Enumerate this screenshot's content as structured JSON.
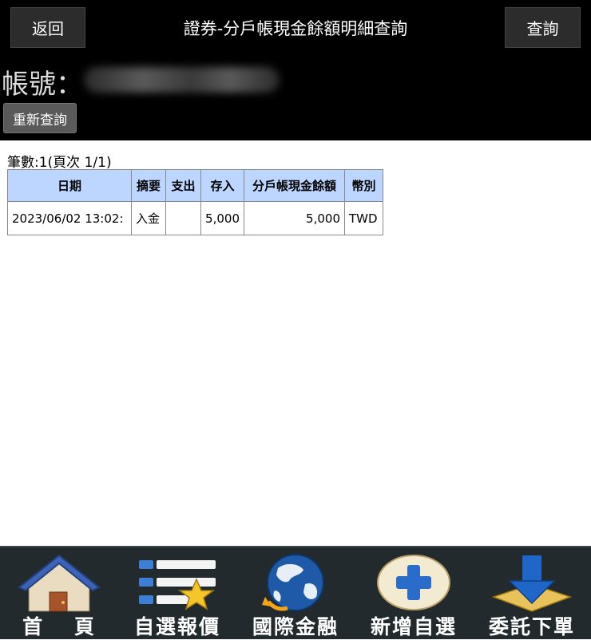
{
  "header": {
    "back_label": "返回",
    "title": "證券-分戶帳現金餘額明細查詢",
    "query_label": "查詢",
    "account_label": "帳號：",
    "requery_label": "重新查詢"
  },
  "result": {
    "count_text": "筆數:1(頁次 1/1)",
    "columns": [
      "日期",
      "摘要",
      "支出",
      "存入",
      "分戶帳現金餘額",
      "幣別"
    ],
    "rows": [
      [
        "2023/06/02 13:02:",
        "入金",
        "",
        "5,000",
        "5,000",
        "TWD"
      ]
    ]
  },
  "tabbar": {
    "items": [
      {
        "label": "首　 頁",
        "icon": "home-icon"
      },
      {
        "label": "自選報價",
        "icon": "watchlist-star-icon"
      },
      {
        "label": "國際金融",
        "icon": "globe-icon"
      },
      {
        "label": "新增自選",
        "icon": "add-plus-icon"
      },
      {
        "label": "委託下單",
        "icon": "order-download-icon"
      }
    ]
  },
  "colors": {
    "header_bg": "#000000",
    "table_header_bg": "#bcd6ff",
    "tabbar_bg": "#222a2e"
  }
}
